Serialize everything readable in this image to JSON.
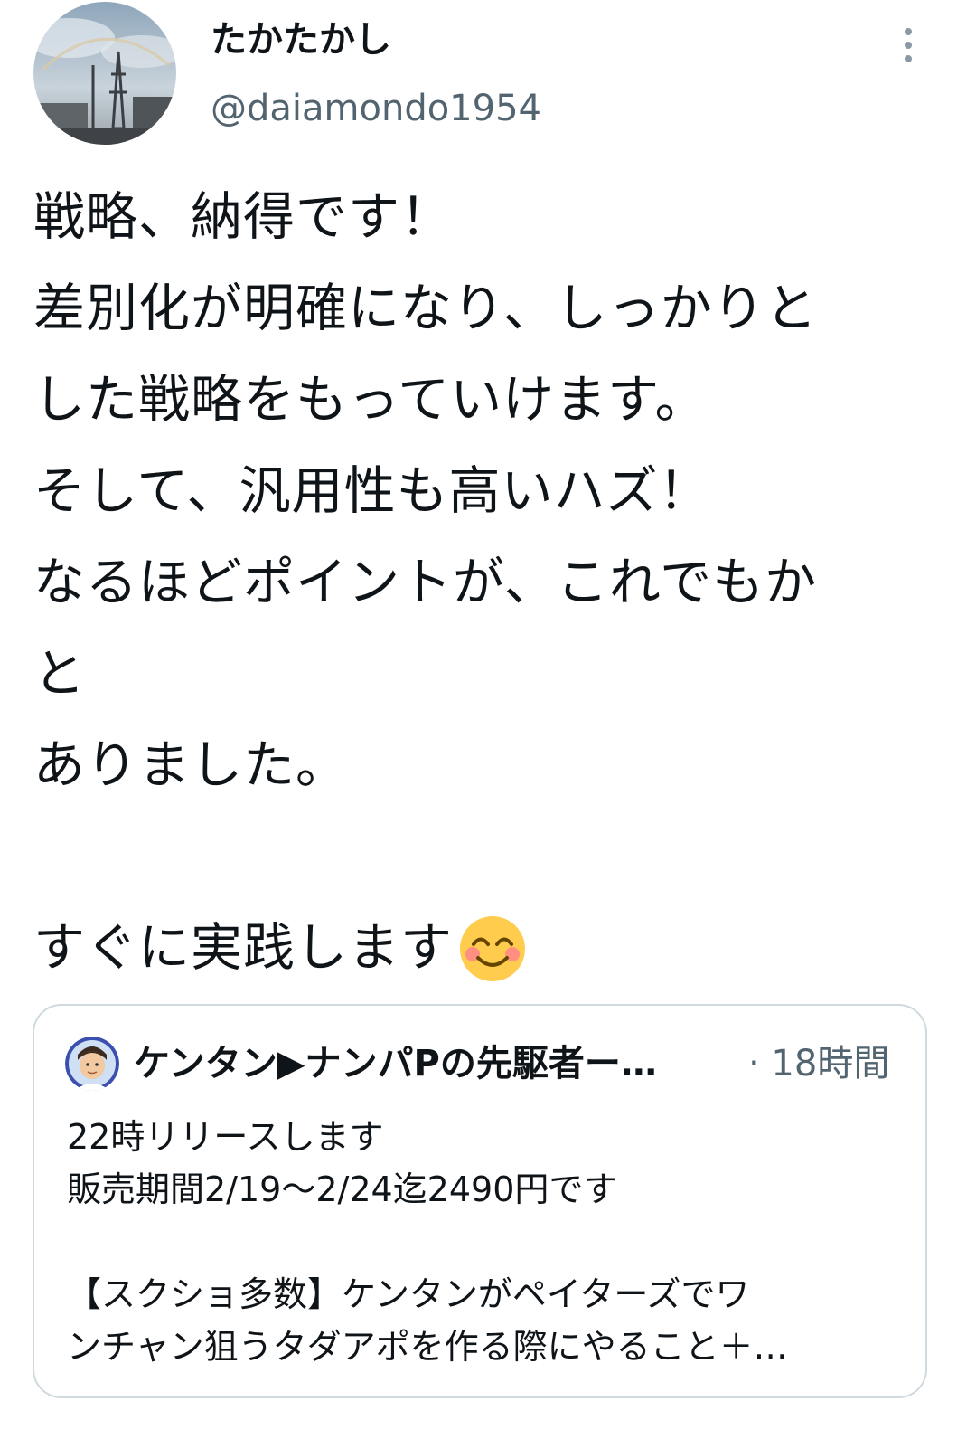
{
  "tweet": {
    "display_name": "たかたかし",
    "handle": "@daiamondo1954",
    "lines": [
      "戦略、納得です！",
      "差別化が明確になり、しっかりと",
      "した戦略をもっていけます。",
      "そして、汎用性も高いハズ！",
      "なるほどポイントが、これでもか",
      "と",
      "ありました。",
      "",
      "すぐに実践します"
    ],
    "emoji": "smiling-face-with-smiling-eyes"
  },
  "quoted": {
    "author": "ケンタン▶ナンパPの先駆者ー…",
    "time": "· 18時間",
    "lines": [
      "22時リリースします",
      "販売期間2/19〜2/24迄2490円です",
      "",
      "【スクショ多数】ケンタンがペイターズでワ",
      "ンチャン狙うタダアポを作る際にやること＋…"
    ]
  },
  "icons": {
    "more": "more-vertical-icon"
  }
}
